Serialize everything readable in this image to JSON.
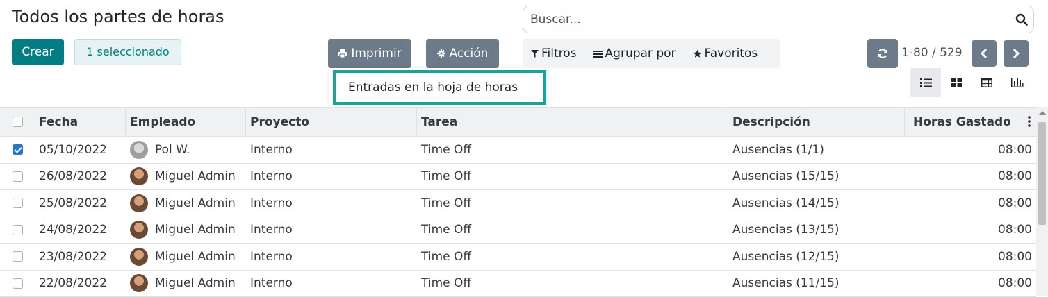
{
  "header": {
    "title": "Todos los partes de horas",
    "create_label": "Crear",
    "selected_label": "1 seleccionado",
    "print_label": "Imprimir",
    "action_label": "Acción",
    "print_menu": {
      "items": [
        {
          "label": "Entradas en la hoja de horas"
        }
      ]
    }
  },
  "search": {
    "placeholder": "Buscar...",
    "icon": "search-icon"
  },
  "filters": {
    "filters_label": "Filtros",
    "groupby_label": "Agrupar por",
    "favorites_label": "Favoritos"
  },
  "pager": {
    "text": "1-80 / 529"
  },
  "views": [
    {
      "name": "list-view-icon",
      "active": true
    },
    {
      "name": "kanban-view-icon",
      "active": false
    },
    {
      "name": "pivot-view-icon",
      "active": false
    },
    {
      "name": "graph-view-icon",
      "active": false
    }
  ],
  "table": {
    "columns": [
      "Fecha",
      "Empleado",
      "Proyecto",
      "Tarea",
      "Descripción",
      "Horas Gastado"
    ],
    "rows": [
      {
        "checked": true,
        "date": "05/10/2022",
        "employee": "Pol W.",
        "avatar": "pol",
        "project": "Interno",
        "task": "Time Off",
        "description": "Ausencias (1/1)",
        "hours": "08:00"
      },
      {
        "checked": false,
        "date": "26/08/2022",
        "employee": "Miguel Admin",
        "avatar": "miguel",
        "project": "Interno",
        "task": "Time Off",
        "description": "Ausencias (15/15)",
        "hours": "08:00"
      },
      {
        "checked": false,
        "date": "25/08/2022",
        "employee": "Miguel Admin",
        "avatar": "miguel",
        "project": "Interno",
        "task": "Time Off",
        "description": "Ausencias (14/15)",
        "hours": "08:00"
      },
      {
        "checked": false,
        "date": "24/08/2022",
        "employee": "Miguel Admin",
        "avatar": "miguel",
        "project": "Interno",
        "task": "Time Off",
        "description": "Ausencias (13/15)",
        "hours": "08:00"
      },
      {
        "checked": false,
        "date": "23/08/2022",
        "employee": "Miguel Admin",
        "avatar": "miguel",
        "project": "Interno",
        "task": "Time Off",
        "description": "Ausencias (12/15)",
        "hours": "08:00"
      },
      {
        "checked": false,
        "date": "22/08/2022",
        "employee": "Miguel Admin",
        "avatar": "miguel",
        "project": "Interno",
        "task": "Time Off",
        "description": "Ausencias (11/15)",
        "hours": "08:00"
      }
    ]
  },
  "colors": {
    "primary": "#017e84",
    "secondary_button": "#6c7a89",
    "highlight": "#1aa39a",
    "checkbox": "#2b74c8"
  }
}
